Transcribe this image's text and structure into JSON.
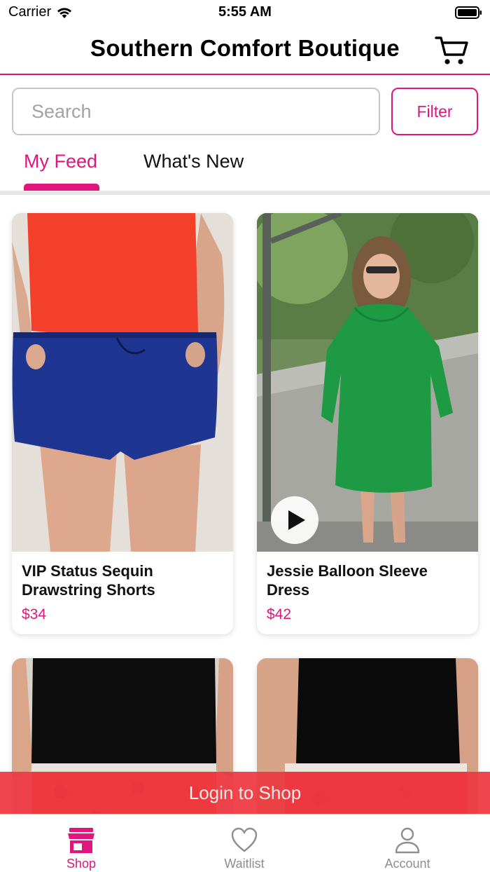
{
  "status_bar": {
    "carrier": "Carrier",
    "time": "5:55 AM"
  },
  "header": {
    "title": "Southern Comfort Boutique",
    "cart_icon": "cart-icon"
  },
  "search": {
    "placeholder": "Search",
    "filter_label": "Filter"
  },
  "tabs": [
    {
      "label": "My Feed",
      "active": true
    },
    {
      "label": "What's New",
      "active": false
    }
  ],
  "products": [
    {
      "name": "VIP Status Sequin Drawstring Shorts",
      "price": "$34",
      "has_video": false
    },
    {
      "name": "Jessie Balloon Sleeve Dress",
      "price": "$42",
      "has_video": true
    },
    {
      "name": "",
      "price": "",
      "has_video": false
    },
    {
      "name": "",
      "price": "",
      "has_video": false
    }
  ],
  "login_banner": "Login to Shop",
  "bottom_nav": [
    {
      "label": "Shop",
      "icon": "storefront-icon",
      "active": true
    },
    {
      "label": "Waitlist",
      "icon": "heart-icon",
      "active": false
    },
    {
      "label": "Account",
      "icon": "user-icon",
      "active": false
    }
  ],
  "colors": {
    "accent": "#e0157d",
    "banner": "#ee3740",
    "inactive": "#8e8e8e"
  }
}
